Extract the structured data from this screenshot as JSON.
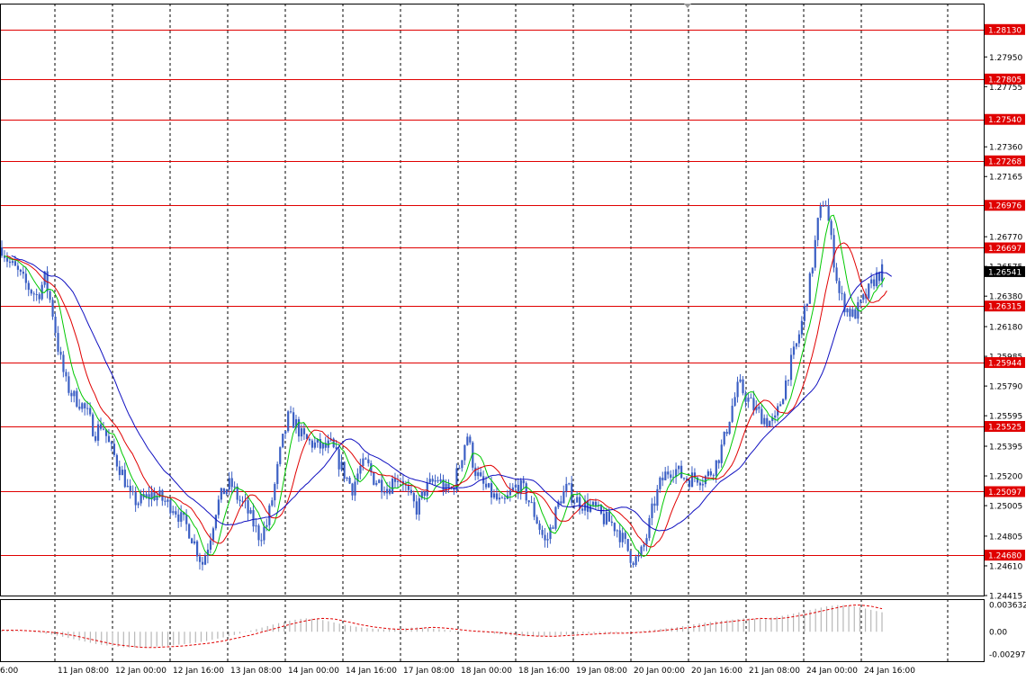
{
  "chart_data": {
    "type": "candlestick",
    "price_ylim": [
      1.24415,
      1.283
    ],
    "osc_ylim": [
      -0.002973,
      0.003632
    ],
    "price_ticks": [
      "1.27950",
      "1.27755",
      "1.27360",
      "1.27165",
      "1.26770",
      "1.26575",
      "1.26380",
      "1.26180",
      "1.25985",
      "1.25790",
      "1.25595",
      "1.25395",
      "1.25200",
      "1.25005",
      "1.24805",
      "1.24610",
      "1.24415"
    ],
    "price_tick_values": [
      1.2795,
      1.27755,
      1.2736,
      1.27165,
      1.2677,
      1.26575,
      1.2638,
      1.2618,
      1.25985,
      1.2579,
      1.25595,
      1.25395,
      1.252,
      1.25005,
      1.24805,
      1.2461,
      1.24415
    ],
    "osc_ticks": [
      "0.003632",
      "0.00",
      "-0.002973"
    ],
    "osc_tick_values": [
      0.003632,
      0,
      -0.002973
    ],
    "time_labels": [
      "6:00",
      "11 Jan 08:00",
      "12 Jan 00:00",
      "12 Jan 16:00",
      "13 Jan 08:00",
      "14 Jan 00:00",
      "14 Jan 16:00",
      "17 Jan 08:00",
      "18 Jan 00:00",
      "18 Jan 16:00",
      "19 Jan 08:00",
      "20 Jan 00:00",
      "20 Jan 16:00",
      "21 Jan 08:00",
      "24 Jan 00:00",
      "24 Jan 16:00"
    ],
    "levels": [
      {
        "label": "1.28130",
        "value": 1.2813
      },
      {
        "label": "1.27805",
        "value": 1.27805
      },
      {
        "label": "1.27540",
        "value": 1.2754
      },
      {
        "label": "1.27268",
        "value": 1.27268
      },
      {
        "label": "1.26976",
        "value": 1.26976
      },
      {
        "label": "1.26697",
        "value": 1.26697
      },
      {
        "label": "1.26315",
        "value": 1.26315
      },
      {
        "label": "1.25944",
        "value": 1.25944
      },
      {
        "label": "1.25525",
        "value": 1.25525
      },
      {
        "label": "1.25097",
        "value": 1.25097
      },
      {
        "label": "1.24680",
        "value": 1.2468
      }
    ],
    "current_price": "1.26541",
    "current_price_value": 1.26541,
    "price_path": [
      1.267,
      1.266,
      1.2655,
      1.2648,
      1.2642,
      1.2638,
      1.265,
      1.263,
      1.26,
      1.258,
      1.2572,
      1.2568,
      1.256,
      1.2548,
      1.2555,
      1.254,
      1.253,
      1.252,
      1.2505,
      1.2503,
      1.2505,
      1.2508,
      1.2506,
      1.2502,
      1.25,
      1.2492,
      1.2486,
      1.2475,
      1.2462,
      1.2478,
      1.25,
      1.251,
      1.2515,
      1.2505,
      1.25,
      1.249,
      1.248,
      1.2488,
      1.251,
      1.2538,
      1.2558,
      1.2555,
      1.2545,
      1.2542,
      1.254,
      1.2538,
      1.254,
      1.253,
      1.252,
      1.2512,
      1.2525,
      1.2528,
      1.2518,
      1.2515,
      1.2512,
      1.252,
      1.2518,
      1.2505,
      1.2498,
      1.251,
      1.2515,
      1.2518,
      1.251,
      1.2512,
      1.2528,
      1.2548,
      1.2525,
      1.2515,
      1.251,
      1.2505,
      1.25,
      1.2508,
      1.2514,
      1.251,
      1.25,
      1.2488,
      1.2475,
      1.249,
      1.2505,
      1.2512,
      1.2505,
      1.2502,
      1.25,
      1.2498,
      1.2492,
      1.249,
      1.2485,
      1.2476,
      1.2466,
      1.2465,
      1.2478,
      1.25,
      1.2515,
      1.2523,
      1.2525,
      1.252,
      1.2518,
      1.252,
      1.2518,
      1.2522,
      1.253,
      1.2545,
      1.2565,
      1.258,
      1.2572,
      1.2565,
      1.256,
      1.2556,
      1.2555,
      1.2572,
      1.259,
      1.2605,
      1.2625,
      1.265,
      1.2685,
      1.2705,
      1.267,
      1.264,
      1.263,
      1.2625,
      1.2632,
      1.264,
      1.265,
      1.26541
    ],
    "osc_path": [
      0.0002,
      0.0001,
      0.0,
      -0.0002,
      -0.0005,
      -0.0009,
      -0.0013,
      -0.0017,
      -0.0019,
      -0.0021,
      -0.0021,
      -0.002,
      -0.0019,
      -0.0017,
      -0.0015,
      -0.0012,
      -0.0008,
      -0.0004,
      0.0001,
      0.0006,
      0.0011,
      0.0015,
      0.0018,
      0.0017,
      0.0013,
      0.0009,
      0.0006,
      0.0004,
      0.0003,
      0.0004,
      0.0006,
      0.0005,
      0.0003,
      0.0001,
      0.0,
      -0.0001,
      -0.0003,
      -0.0005,
      -0.0006,
      -0.0006,
      -0.0005,
      -0.0004,
      -0.0003,
      -0.0002,
      -0.0002,
      -0.0001,
      0.0,
      0.0002,
      0.0004,
      0.0006,
      0.0009,
      0.0012,
      0.0014,
      0.0016,
      0.0018,
      0.0017,
      0.0019,
      0.0022,
      0.0026,
      0.003,
      0.0034,
      0.0036,
      0.0034,
      0.003,
      0.0026
    ]
  }
}
